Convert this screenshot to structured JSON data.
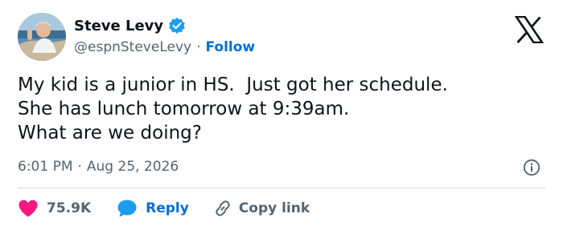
{
  "author": {
    "name": "Steve Levy",
    "handle": "@espnSteveLevy",
    "separator": "·",
    "follow_label": "Follow",
    "verified_icon": "verified-badge-icon",
    "verified_color": "#1d9bf0"
  },
  "brand": {
    "logo_icon": "x-logo-icon"
  },
  "tweet": {
    "lines": [
      "My kid is a junior in HS.  Just got her schedule.",
      "She has lunch tomorrow at 9:39am.",
      "What are we doing?"
    ]
  },
  "meta": {
    "time": "6:01 PM",
    "separator": "·",
    "date": "Aug 25, 2026",
    "info_icon": "info-icon"
  },
  "actions": {
    "like": {
      "icon": "heart-icon",
      "count": "75.9K",
      "color": "#f91880"
    },
    "reply": {
      "icon": "speech-bubble-icon",
      "label": "Reply",
      "color": "#1d9bf0"
    },
    "copy_link": {
      "icon": "link-icon",
      "label": "Copy link"
    }
  },
  "colors": {
    "text": "#0f1419",
    "muted": "#536471",
    "link": "#006fd6",
    "divider": "#cfd9de"
  }
}
